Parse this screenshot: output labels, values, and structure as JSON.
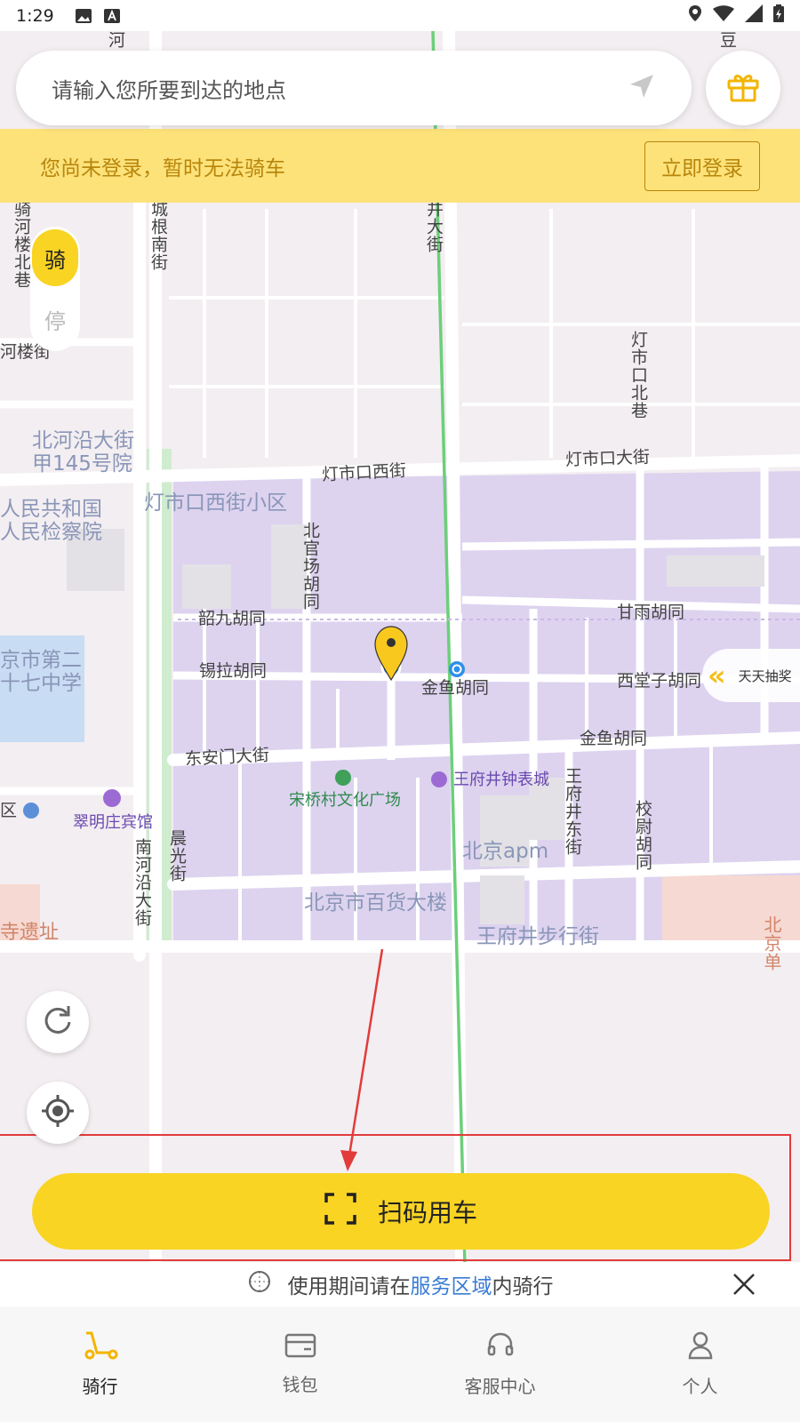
{
  "status_bar": {
    "time": "1:29"
  },
  "search": {
    "placeholder": "请输入您所要到达的地点"
  },
  "login_banner": {
    "message": "您尚未登录，暂时无法骑车",
    "button": "立即登录"
  },
  "mode_toggle": {
    "ride": "骑",
    "park": "停"
  },
  "lottery": {
    "label": "天天抽奖"
  },
  "map_labels": {
    "top_a": "河",
    "top_b": "豆",
    "huaihe_north": "骑河楼北巷",
    "beiheyan_street": "北河沿大街甲145号院",
    "heloujie": "河楼街",
    "chengnan": "城根南街",
    "jingda": "井大街",
    "dengshikou_north": "灯市口北巷",
    "dengshikou_west": "灯市口西街",
    "dengshikou_main": "灯市口大街",
    "dengshikou_xiaoqu": "灯市口西街小区",
    "procuratorate": "人民共和国人民检察院",
    "beiguan": "北官场胡同",
    "ganyu": "甘雨胡同",
    "shaojiu": "韶九胡同",
    "xila": "锡拉胡同",
    "jinyu_1": "金鱼胡同",
    "jinyu_2": "金鱼胡同",
    "xitangzi": "西堂子胡同",
    "school": "京市第二十七中学",
    "dongan": "东安门大街",
    "songqiao": "宋桥村文化广场",
    "wangfujing_clock": "王府井钟表城",
    "wangfujing_east": "王府井东街",
    "xiaowei": "校尉胡同",
    "cuiming": "翠明庄宾馆",
    "nanheyan": "南河沿大街",
    "chenguang": "晨光街",
    "apm": "北京apm",
    "baihuo": "北京市百货大楼",
    "pedestrian": "王府井步行街",
    "temple": "寺遗址",
    "qu": "区",
    "bei_right": "北京单"
  },
  "scan_button": {
    "label": "扫码用车"
  },
  "notice": {
    "prefix": "使用期间请在",
    "link": "服务区域",
    "suffix": "内骑行"
  },
  "tabs": [
    {
      "label": "骑行",
      "icon": "scooter-icon",
      "active": true
    },
    {
      "label": "钱包",
      "icon": "wallet-icon",
      "active": false
    },
    {
      "label": "客服中心",
      "icon": "headset-icon",
      "active": false
    },
    {
      "label": "个人",
      "icon": "person-icon",
      "active": false
    }
  ],
  "colors": {
    "accent": "#f9d423",
    "banner_bg": "#fde27a",
    "banner_text": "#b8860b",
    "link": "#3a7bd5",
    "highlight": "#e23b3b",
    "district": "#ddd3ef"
  }
}
